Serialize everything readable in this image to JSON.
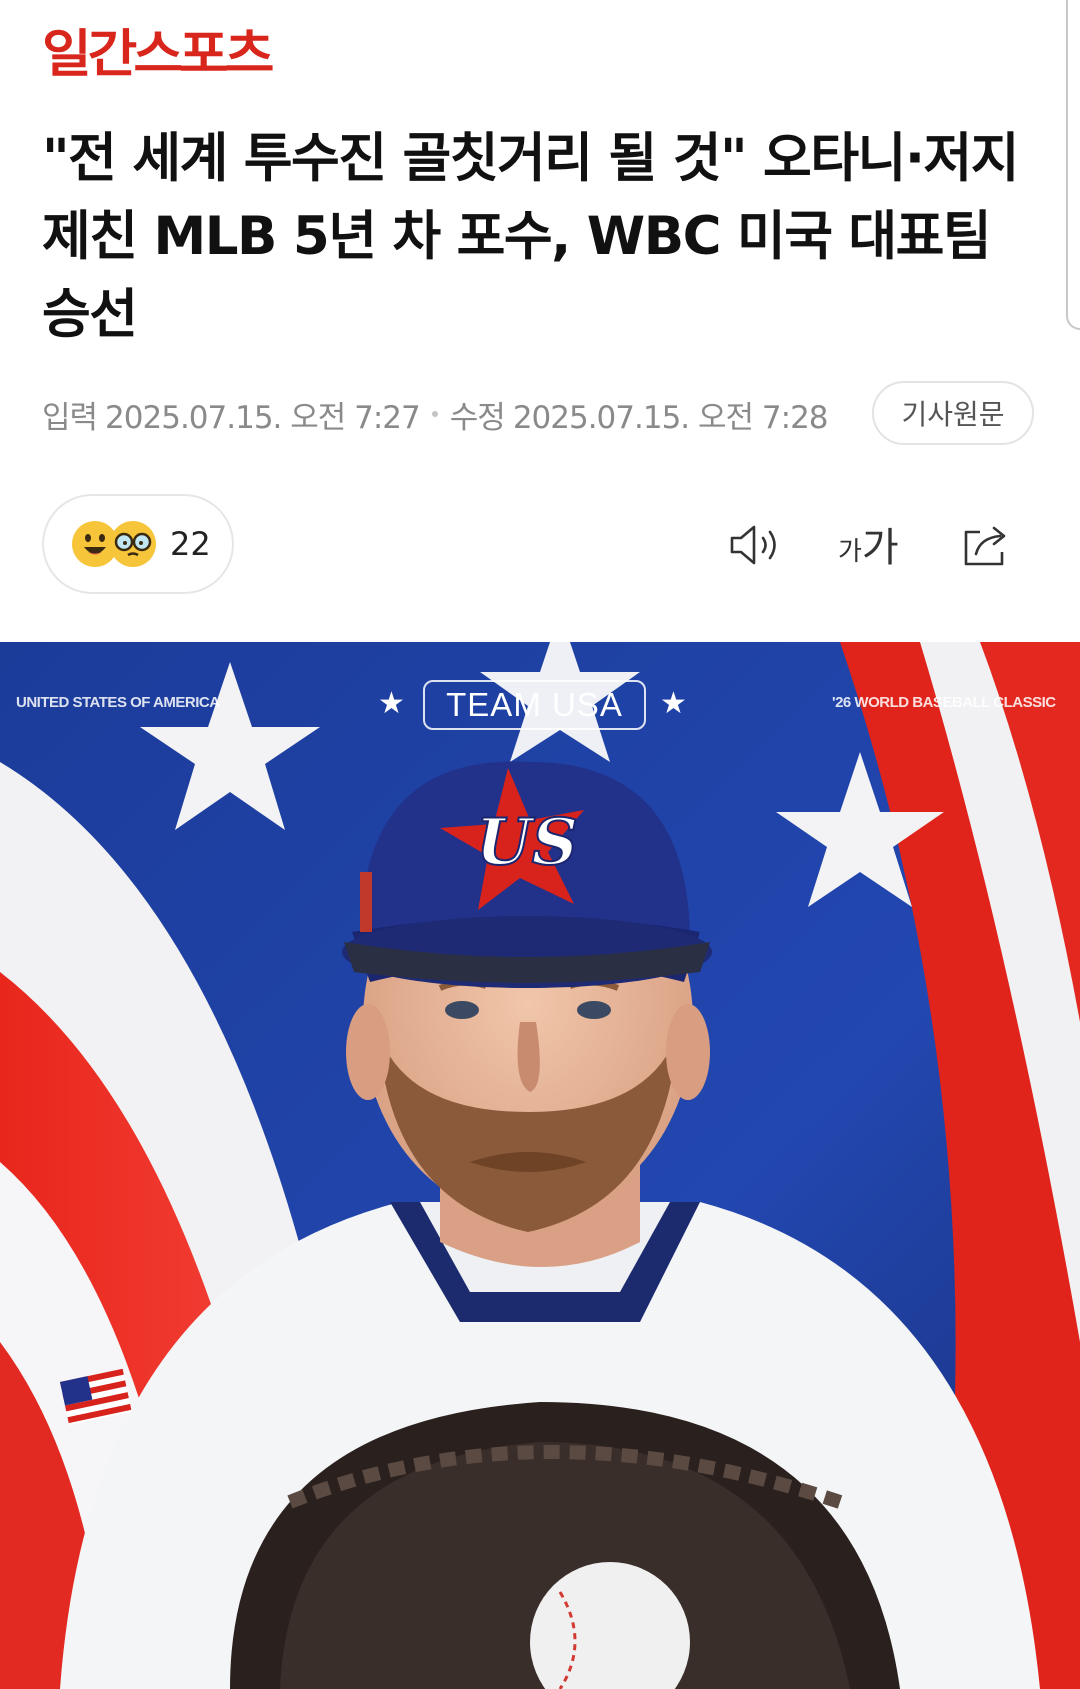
{
  "header": {
    "logo_text": "일간스포츠"
  },
  "article": {
    "headline": "\"전 세계 투수진 골칫거리 될 것\" 오타니·저지 제친 MLB 5년 차 포수, WBC 미국 대표팀 승선",
    "input_label": "입력",
    "input_time": "2025.07.15. 오전 7:27",
    "edit_label": "수정",
    "edit_time": "2025.07.15. 오전 7:28",
    "original_button": "기사원문"
  },
  "toolbar": {
    "reaction_count": "22",
    "font_small": "가",
    "font_large": "가",
    "icons": [
      "smile-emoji-icon",
      "glasses-emoji-icon",
      "speaker-icon",
      "font-size-icon",
      "share-icon"
    ]
  },
  "photo": {
    "left_caption": "UNITED STATES OF AMERICA",
    "center_badge": "TEAM USA",
    "right_caption": "'26 WORLD BASEBALL CLASSIC",
    "cap_logo": "US"
  },
  "colors": {
    "brand_red": "#d9261c",
    "flag_blue": "#1f3a8c",
    "flag_red": "#d8201c",
    "meta_gray": "#8a8a8a"
  }
}
